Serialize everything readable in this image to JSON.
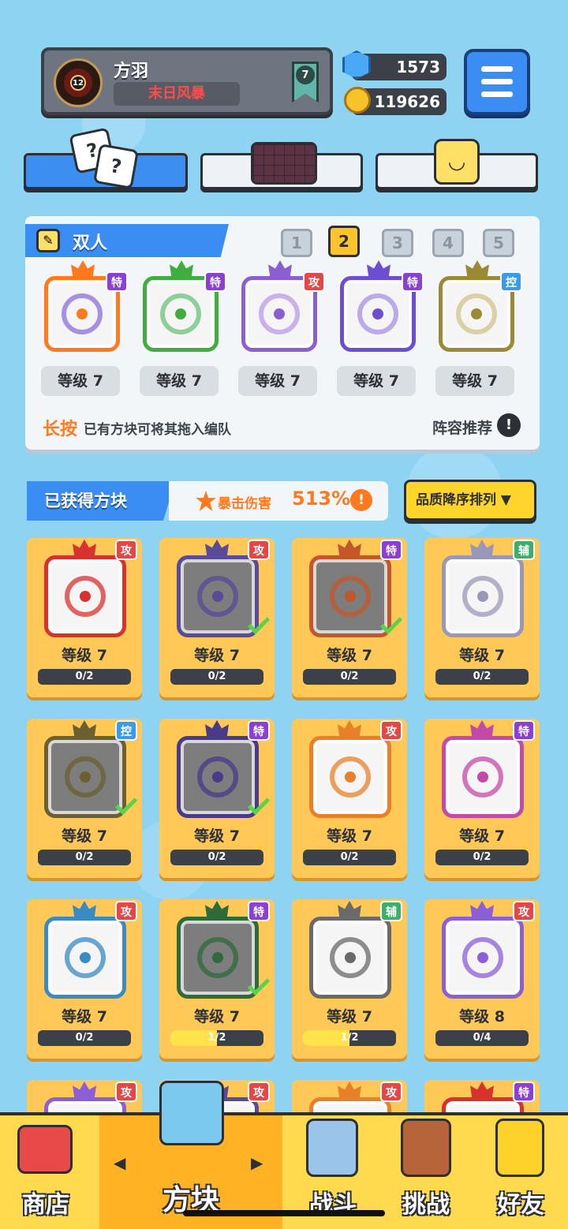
{
  "player": {
    "name": "方羽",
    "title": "末日风暴",
    "avatar_level": "12",
    "rank": "7"
  },
  "currency": {
    "gems": "1573",
    "coins": "119626"
  },
  "team": {
    "title": "双人",
    "pages": [
      "1",
      "2",
      "3",
      "4",
      "5"
    ],
    "active_page": "2",
    "slots": [
      {
        "tag": "特",
        "level": "等级 7",
        "color": "#ff7a1f",
        "ring": "#8b6dd8"
      },
      {
        "tag": "特",
        "level": "等级 7",
        "color": "#3fae3f",
        "ring": "#6ac27a"
      },
      {
        "tag": "攻",
        "level": "等级 7",
        "color": "#8b5fd0",
        "ring": "#b89ae8"
      },
      {
        "tag": "特",
        "level": "等级 7",
        "color": "#6b4fd0",
        "ring": "#a690e6"
      },
      {
        "tag": "控",
        "level": "等级 7",
        "color": "#9a8a36",
        "ring": "#cfc48a"
      }
    ],
    "hint_emphasis": "长按",
    "hint_text": "已有方块可将其拖入编队",
    "recommend_label": "阵容推荐"
  },
  "owned": {
    "title": "已获得方块",
    "crit_label": "暴击伤害",
    "crit_value": "513%",
    "sort_label": "品质降序排列 ▼",
    "cards": [
      {
        "tag": "攻",
        "level": "等级 7",
        "progress": "0/2",
        "fill": 0,
        "color": "#d8322f",
        "dim": false,
        "check": false
      },
      {
        "tag": "攻",
        "level": "等级 7",
        "progress": "0/2",
        "fill": 0,
        "color": "#5a4a9a",
        "dim": true,
        "check": true
      },
      {
        "tag": "特",
        "level": "等级 7",
        "progress": "0/2",
        "fill": 0,
        "color": "#c4572a",
        "dim": true,
        "check": true
      },
      {
        "tag": "辅",
        "level": "等级 7",
        "progress": "0/2",
        "fill": 0,
        "color": "#9a98b8",
        "dim": false,
        "check": false
      },
      {
        "tag": "控",
        "level": "等级 7",
        "progress": "0/2",
        "fill": 0,
        "color": "#6a6030",
        "dim": true,
        "check": true
      },
      {
        "tag": "特",
        "level": "等级 7",
        "progress": "0/2",
        "fill": 0,
        "color": "#4a3a8a",
        "dim": true,
        "check": true
      },
      {
        "tag": "攻",
        "level": "等级 7",
        "progress": "0/2",
        "fill": 0,
        "color": "#e8802a",
        "dim": false,
        "check": false
      },
      {
        "tag": "特",
        "level": "等级 7",
        "progress": "0/2",
        "fill": 0,
        "color": "#c44aa8",
        "dim": false,
        "check": false
      },
      {
        "tag": "攻",
        "level": "等级 7",
        "progress": "0/2",
        "fill": 0,
        "color": "#3a8ac4",
        "dim": false,
        "check": false
      },
      {
        "tag": "特",
        "level": "等级 7",
        "progress": "1/2",
        "fill": 0.5,
        "color": "#2f6a3a",
        "dim": true,
        "check": true
      },
      {
        "tag": "辅",
        "level": "等级 7",
        "progress": "1/2",
        "fill": 0.5,
        "color": "#6a6a6a",
        "dim": false,
        "check": false
      },
      {
        "tag": "攻",
        "level": "等级 8",
        "progress": "0/4",
        "fill": 0,
        "color": "#8a5fd8",
        "dim": false,
        "check": false
      },
      {
        "tag": "攻",
        "partial": true,
        "color": "#8a5fd8"
      },
      {
        "tag": "攻",
        "partial": true,
        "color": "#5a4a9a"
      },
      {
        "tag": "攻",
        "partial": true,
        "color": "#e8802a"
      },
      {
        "tag": "特",
        "partial": true,
        "color": "#d8322f"
      }
    ]
  },
  "nav": {
    "shop": "商店",
    "blocks": "方块",
    "battle": "战斗",
    "challenge": "挑战",
    "friends": "好友",
    "left_arrow": "◀",
    "right_arrow": "▶"
  },
  "icons": {
    "menu": "hamburger-icon",
    "gem": "gem-icon",
    "coin": "coin-icon"
  }
}
